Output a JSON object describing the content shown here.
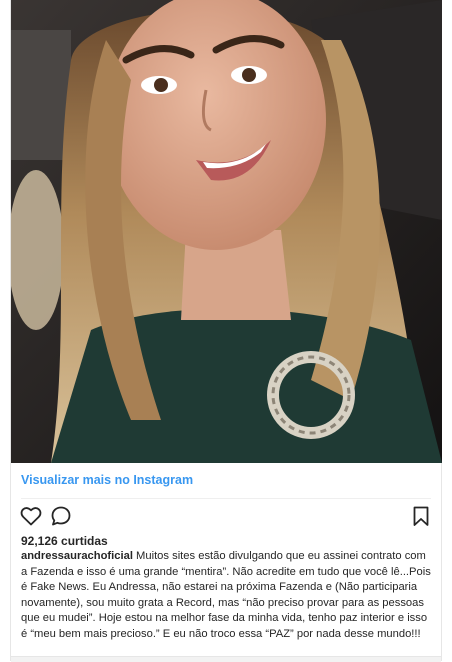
{
  "post": {
    "image_alt": "selfie photo",
    "view_link": "Visualizar mais no Instagram",
    "likes": "92,126 curtidas",
    "username": "andressaurachoficial",
    "caption": "Muitos sites estão divulgando que eu assinei contrato com a Fazenda e isso é uma grande “mentira”. Não acredite em tudo que você lê...Pois é Fake News. Eu Andressa, não estarei na próxima Fazenda e (Não participaria novamente), sou muito grata a Record, mas “não preciso provar para as pessoas que eu mudei”. Hoje estou na melhor fase da minha vida, tenho paz interior e isso é “meu bem mais precioso.” E eu não troco essa “PAZ” por nada desse mundo!!!"
  },
  "icons": {
    "like": "heart-outline-icon",
    "comment": "speech-bubble-icon",
    "save": "bookmark-icon"
  },
  "colors": {
    "link": "#3897f0",
    "text": "#262626"
  }
}
